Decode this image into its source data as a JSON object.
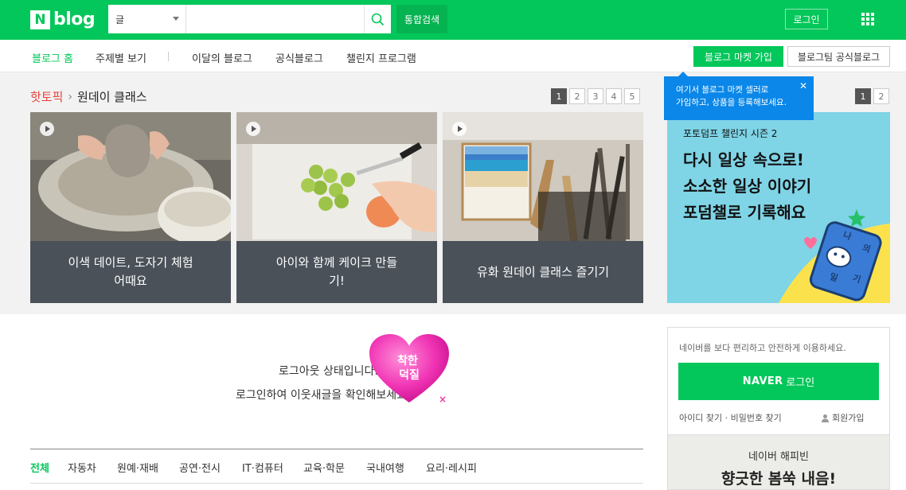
{
  "header": {
    "logo_letter": "N",
    "logo_text": "blog",
    "search_category": "글",
    "search_placeholder": "",
    "integrated_search_label": "통합검색",
    "login_label": "로그인"
  },
  "nav": {
    "items": [
      "블로그 홈",
      "주제별 보기",
      "이달의 블로그",
      "공식블로그",
      "챌린지 프로그램"
    ],
    "market_button": "블로그 마켓 가입",
    "official_button": "블로그팀 공식블로그"
  },
  "hot_topic": {
    "label": "핫토픽",
    "topic": "원데이 클래스",
    "pages": [
      "1",
      "2",
      "3",
      "4",
      "5"
    ],
    "cards": [
      {
        "caption": "이색 데이트, 도자기 체험 어때요"
      },
      {
        "caption": "아이와 함께 케이크 만들기!"
      },
      {
        "caption": "유화 원데이 클래스 즐기기"
      }
    ]
  },
  "tooltip": {
    "line1": "여기서 블로그 마켓 셀러로",
    "line2": "가입하고, 상품을 등록해보세요.",
    "close": "✕"
  },
  "promo": {
    "pages": [
      "1",
      "2"
    ],
    "subtitle": "포토덤프 챌린지 시즌 2",
    "line1": "다시 일상 속으로!",
    "line2": "소소한 일상 이야기",
    "line3": "포덤챌로 기록해요",
    "diary_text": [
      "나",
      "의",
      "일",
      "기"
    ]
  },
  "logout": {
    "line1": "로그아웃 상태입니다.",
    "line2": "로그인하여 이웃새글을 확인해보세요.",
    "heart_text": [
      "착한",
      "덕질"
    ],
    "heart_close": "×"
  },
  "categories": [
    "전체",
    "자동차",
    "원예·재배",
    "공연·전시",
    "IT·컴퓨터",
    "교육·학문",
    "국내여행",
    "요리·레시피"
  ],
  "loginbox": {
    "message": "네이버를 보다 편리하고 안전하게 이용하세요.",
    "naver": "NAVER",
    "button_suffix": "로그인",
    "links": "아이디 찾기 · 비밀번호 찾기",
    "join": "회원가입"
  },
  "happybean": {
    "title": "네이버 해피빈",
    "headline": "향긋한 봄쑥 내음!"
  },
  "colors": {
    "brand": "#03c75a",
    "tooltip": "#0a87e8",
    "hot_red": "#e4413b",
    "heart": "#e83fa7"
  }
}
